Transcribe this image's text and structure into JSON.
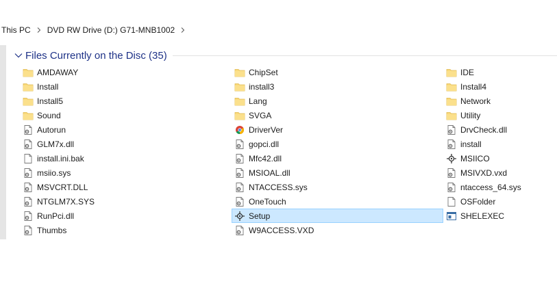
{
  "breadcrumb": {
    "items": [
      "This PC",
      "DVD RW Drive (D:) G71-MNB1002"
    ]
  },
  "group": {
    "title": "Files Currently on the Disc (35)"
  },
  "colors": {
    "folder": "#f8d775",
    "selection_bg": "#cce8ff",
    "selection_border": "#99d1ff",
    "group_title": "#1e3287"
  },
  "files": [
    {
      "name": "AMDAWAY",
      "icon": "folder-icon"
    },
    {
      "name": "ChipSet",
      "icon": "folder-icon"
    },
    {
      "name": "IDE",
      "icon": "folder-icon"
    },
    {
      "name": "Install",
      "icon": "folder-icon"
    },
    {
      "name": "install3",
      "icon": "folder-icon"
    },
    {
      "name": "Install4",
      "icon": "folder-icon"
    },
    {
      "name": "Install5",
      "icon": "folder-icon"
    },
    {
      "name": "Lang",
      "icon": "folder-icon"
    },
    {
      "name": "Network",
      "icon": "folder-icon"
    },
    {
      "name": "Sound",
      "icon": "folder-icon"
    },
    {
      "name": "SVGA",
      "icon": "folder-icon"
    },
    {
      "name": "Utility",
      "icon": "folder-icon"
    },
    {
      "name": "Autorun",
      "icon": "settings-file-icon"
    },
    {
      "name": "DriverVer",
      "icon": "chrome-file-icon"
    },
    {
      "name": "DrvCheck.dll",
      "icon": "settings-file-icon"
    },
    {
      "name": "GLM7x.dll",
      "icon": "settings-file-icon"
    },
    {
      "name": "gopci.dll",
      "icon": "settings-file-icon"
    },
    {
      "name": "install",
      "icon": "settings-file-icon"
    },
    {
      "name": "install.ini.bak",
      "icon": "blank-file-icon"
    },
    {
      "name": "Mfc42.dll",
      "icon": "settings-file-icon"
    },
    {
      "name": "MSIICO",
      "icon": "app-icon"
    },
    {
      "name": "msiio.sys",
      "icon": "settings-file-icon"
    },
    {
      "name": "MSIOAL.dll",
      "icon": "settings-file-icon"
    },
    {
      "name": "MSIVXD.vxd",
      "icon": "settings-file-icon"
    },
    {
      "name": "MSVCRT.DLL",
      "icon": "settings-file-icon"
    },
    {
      "name": "NTACCESS.sys",
      "icon": "settings-file-icon"
    },
    {
      "name": "ntaccess_64.sys",
      "icon": "settings-file-icon"
    },
    {
      "name": "NTGLM7X.SYS",
      "icon": "settings-file-icon"
    },
    {
      "name": "OneTouch",
      "icon": "settings-file-icon"
    },
    {
      "name": "OSFolder",
      "icon": "blank-file-icon"
    },
    {
      "name": "RunPci.dll",
      "icon": "settings-file-icon"
    },
    {
      "name": "Setup",
      "icon": "app-icon",
      "selected": true
    },
    {
      "name": "SHELEXEC",
      "icon": "window-app-icon"
    },
    {
      "name": "Thumbs",
      "icon": "settings-file-icon"
    },
    {
      "name": "W9ACCESS.VXD",
      "icon": "settings-file-icon"
    }
  ]
}
